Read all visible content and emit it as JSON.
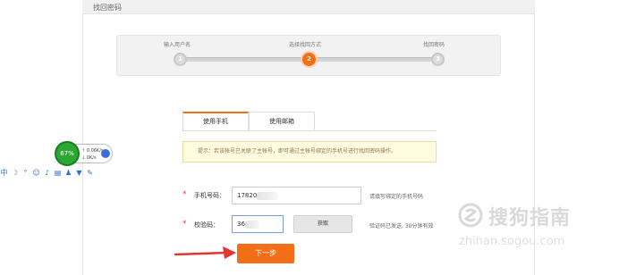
{
  "page": {
    "title": "找回密码"
  },
  "steps": [
    {
      "label": "输入用户名",
      "number": "1",
      "active": false
    },
    {
      "label": "选择找回方式",
      "number": "2",
      "active": true
    },
    {
      "label": "找回密码",
      "number": "3",
      "active": false
    }
  ],
  "tabs": [
    {
      "label": "使用手机",
      "active": true
    },
    {
      "label": "使用邮箱",
      "active": false
    }
  ],
  "notice": "提示：若该帐号已关联了主帐号，即可通过主帐号绑定的手机号进行找回密码操作。",
  "phone": {
    "required_mark": "*",
    "label": "手机号码：",
    "value": "17820",
    "hint": "请填写绑定的手机号码"
  },
  "code": {
    "required_mark": "*",
    "label": "校验码：",
    "value": "36",
    "get_button": "获取",
    "hint": "验证码已发送, 30分钟有效"
  },
  "next_button": "下一步",
  "net_widget": {
    "percent": "67%",
    "upload": "0.06K/s",
    "download": "0K/s"
  },
  "watermark": {
    "title": "搜狗指南",
    "url": "zhinan.sogou.com"
  },
  "colors": {
    "accent": "#f26f17",
    "required": "#e4393c",
    "notice_bg": "#fffbe0"
  }
}
